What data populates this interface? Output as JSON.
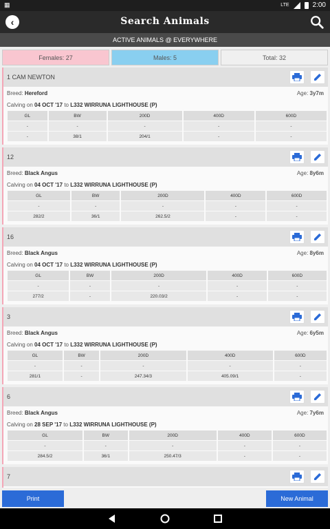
{
  "status": {
    "left_icon": "android-icon",
    "network": "LTE",
    "time": "2:00"
  },
  "header": {
    "title": "Search Animals"
  },
  "subtitle": "ACTIVE ANIMALS @ EVERYWHERE",
  "counts": {
    "females": "Females: 27",
    "males": "Males: 5",
    "total": "Total: 32"
  },
  "table_headers": [
    "GL",
    "BW",
    "200D",
    "400D",
    "600D"
  ],
  "animals": [
    {
      "id": "1 CAM NEWTON",
      "breed_label": "Breed:",
      "breed": "Hereford",
      "age_label": "Age:",
      "age": "3y7m",
      "calving_prefix": "Calving on",
      "calving_date": "04 OCT '17",
      "calving_to": "to",
      "calving_sire": "L332 WIRRUNA LIGHTHOUSE (P)",
      "row1": [
        "-",
        "-",
        "-",
        "-",
        "-"
      ],
      "row2": [
        "-",
        "38/1",
        "204/1",
        "-",
        "-"
      ]
    },
    {
      "id": "12",
      "breed_label": "Breed:",
      "breed": "Black Angus",
      "age_label": "Age:",
      "age": "8y6m",
      "calving_prefix": "Calving on",
      "calving_date": "04 OCT '17",
      "calving_to": "to",
      "calving_sire": "L332 WIRRUNA LIGHTHOUSE (P)",
      "row1": [
        "-",
        "-",
        "-",
        "-",
        "-"
      ],
      "row2": [
        "282/2",
        "36/1",
        "262.5/2",
        "-",
        "-"
      ]
    },
    {
      "id": "16",
      "breed_label": "Breed:",
      "breed": "Black Angus",
      "age_label": "Age:",
      "age": "8y6m",
      "calving_prefix": "Calving on",
      "calving_date": "04 OCT '17",
      "calving_to": "to",
      "calving_sire": "L332 WIRRUNA LIGHTHOUSE (P)",
      "row1": [
        "-",
        "-",
        "-",
        "-",
        "-"
      ],
      "row2": [
        "277/2",
        "-",
        "220.03/2",
        "-",
        "-"
      ]
    },
    {
      "id": "3",
      "breed_label": "Breed:",
      "breed": "Black Angus",
      "age_label": "Age:",
      "age": "6y5m",
      "calving_prefix": "Calving on",
      "calving_date": "04 OCT '17",
      "calving_to": "to",
      "calving_sire": "L332 WIRRUNA LIGHTHOUSE (P)",
      "row1": [
        "-",
        "-",
        "-",
        "-",
        "-"
      ],
      "row2": [
        "281/1",
        "-",
        "247.34/3",
        "405.09/1",
        "-"
      ]
    },
    {
      "id": "6",
      "breed_label": "Breed:",
      "breed": "Black Angus",
      "age_label": "Age:",
      "age": "7y6m",
      "calving_prefix": "Calving on",
      "calving_date": "28 SEP '17",
      "calving_to": "to",
      "calving_sire": "L332 WIRRUNA LIGHTHOUSE (P)",
      "row1": [
        "-",
        "-",
        "-",
        "-",
        "-"
      ],
      "row2": [
        "284.5/2",
        "36/1",
        "250.47/3",
        "-",
        "-"
      ]
    },
    {
      "id": "7",
      "breed_label": "",
      "breed": "",
      "age_label": "",
      "age": "",
      "calving_prefix": "",
      "calving_date": "",
      "calving_to": "",
      "calving_sire": "",
      "row1": [],
      "row2": []
    }
  ],
  "buttons": {
    "print": "Print",
    "new_animal": "New Animal"
  },
  "colors": {
    "accent": "#2b6bd7",
    "female": "#f9c6d0",
    "male": "#89cff0",
    "appbar": "#2a2a2a"
  }
}
